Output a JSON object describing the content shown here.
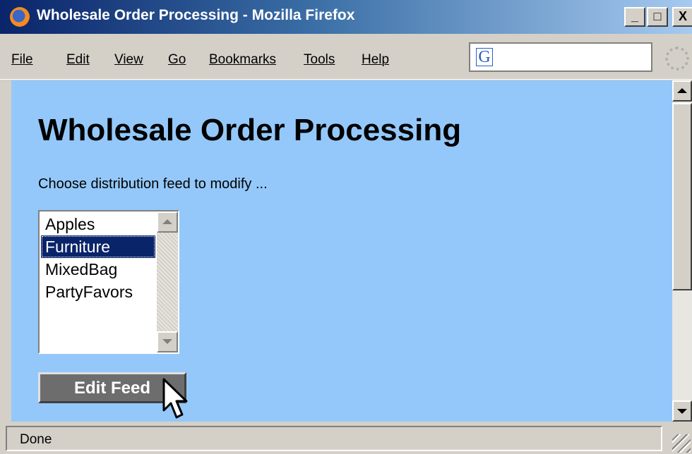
{
  "window": {
    "title": "Wholesale Order Processing - Mozilla Firefox",
    "controls": {
      "minimize": "_",
      "maximize": "□",
      "close": "X"
    }
  },
  "menubar": {
    "items": [
      "File",
      "Edit",
      "View",
      "Go",
      "Bookmarks",
      "Tools",
      "Help"
    ]
  },
  "search": {
    "engine_icon": "G",
    "value": ""
  },
  "page": {
    "title": "Wholesale Order Processing",
    "prompt": "Choose distribution feed to modify ...",
    "feeds": [
      "Apples",
      "Furniture",
      "MixedBag",
      "PartyFavors"
    ],
    "selected_feed": "Furniture",
    "edit_button": "Edit Feed"
  },
  "statusbar": {
    "text": "Done"
  },
  "icons": {
    "app": "firefox-icon",
    "search_engine": "google-icon",
    "throbber": "throbber-icon",
    "cursor": "mouse-pointer-icon"
  },
  "colors": {
    "page_background": "#94c8fa",
    "selection": "#0a246a",
    "button": "#6d6d6d"
  }
}
